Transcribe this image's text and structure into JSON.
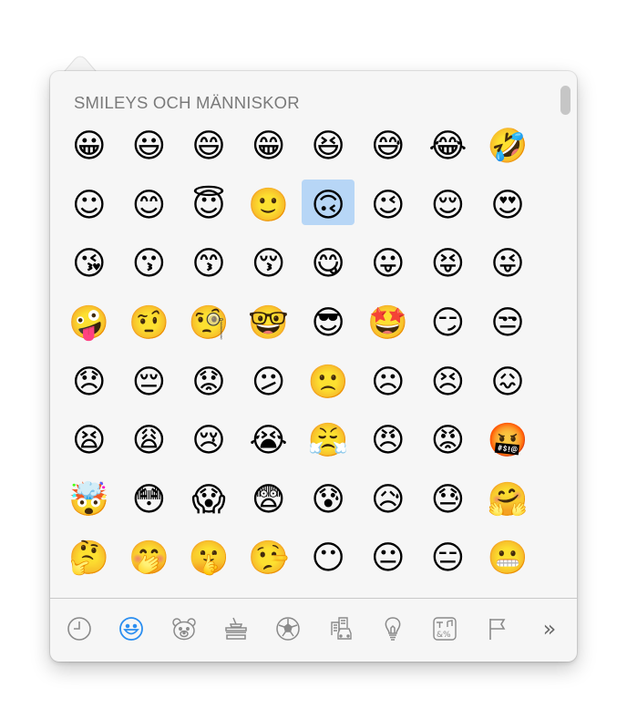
{
  "section_title": "SMILEYS OCH MÄNNISKOR",
  "emojis": [
    "😀",
    "😃",
    "😄",
    "😁",
    "😆",
    "😅",
    "😂",
    "🤣",
    "☺",
    "😊",
    "😇",
    "🙂",
    "🙃",
    "😉",
    "😌",
    "😍",
    "😘",
    "😗",
    "😙",
    "😚",
    "😋",
    "😛",
    "😝",
    "😜",
    "🤪",
    "🤨",
    "🧐",
    "🤓",
    "😎",
    "🤩",
    "😏",
    "😒",
    "😞",
    "😔",
    "😟",
    "😕",
    "🙁",
    "☹",
    "😣",
    "😖",
    "😫",
    "😩",
    "😢",
    "😭",
    "😤",
    "😠",
    "😡",
    "🤬",
    "🤯",
    "😳",
    "😱",
    "😨",
    "😰",
    "😥",
    "😓",
    "🤗",
    "🤔",
    "🤭",
    "🤫",
    "🤥",
    "😶",
    "😐",
    "😑",
    "😬"
  ],
  "selected_index": 12,
  "tabs": [
    {
      "id": "recent",
      "icon": "clock-icon"
    },
    {
      "id": "smileys",
      "icon": "smiley-icon",
      "active": true
    },
    {
      "id": "animals",
      "icon": "bear-icon"
    },
    {
      "id": "food",
      "icon": "food-icon"
    },
    {
      "id": "activity",
      "icon": "soccer-ball-icon"
    },
    {
      "id": "travel",
      "icon": "buildings-car-icon"
    },
    {
      "id": "objects",
      "icon": "lightbulb-icon"
    },
    {
      "id": "symbols",
      "icon": "symbols-icon"
    },
    {
      "id": "flags",
      "icon": "flag-icon"
    }
  ],
  "more_label": "»",
  "accent_color": "#2b8ef0"
}
